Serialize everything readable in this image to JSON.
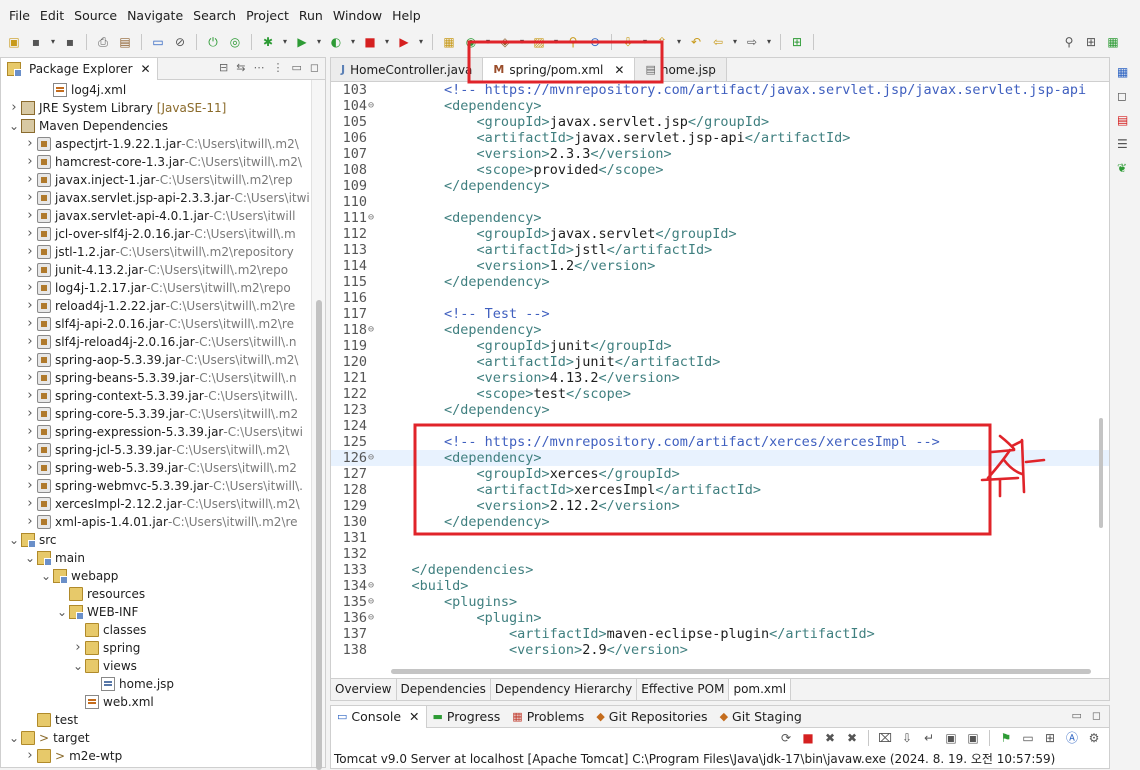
{
  "menus": [
    "File",
    "Edit",
    "Source",
    "Navigate",
    "Search",
    "Project",
    "Run",
    "Window",
    "Help"
  ],
  "toolbar_icons": [
    "new-icon",
    "save-icon",
    "save-all-icon",
    "print-icon",
    "properties-icon",
    "terminal-icon",
    "skip-icon",
    "power-icon",
    "refresh-icon",
    "debug-icon",
    "run-icon",
    "coverage-icon",
    "stop-icon",
    "external-tools-icon",
    "server-icon",
    "deploy-icon",
    "build-icon",
    "open-type-icon",
    "search-icon",
    "pin-icon",
    "next-annotation-icon",
    "prev-annotation-icon",
    "last-edit-icon",
    "back-icon",
    "forward-icon",
    "new-window-icon",
    "quick-access-icon",
    "open-perspective-icon",
    "java-perspective-icon"
  ],
  "explorer": {
    "title": "Package Explorer",
    "tree": [
      {
        "label": "log4j.xml",
        "icon": "xml",
        "depth": 3,
        "twisty": ""
      },
      {
        "label": "JRE System Library",
        "decoration": "[JavaSE-11]",
        "icon": "lib",
        "depth": 1,
        "twisty": "right"
      },
      {
        "label": "Maven Dependencies",
        "icon": "lib",
        "depth": 1,
        "twisty": "down"
      },
      {
        "label": "aspectjrt-1.9.22.1.jar",
        "path": "C:\\Users\\itwill\\.m2\\",
        "icon": "jar",
        "depth": 2,
        "twisty": "right"
      },
      {
        "label": "hamcrest-core-1.3.jar",
        "path": "C:\\Users\\itwill\\.m2\\",
        "icon": "jar",
        "depth": 2,
        "twisty": "right"
      },
      {
        "label": "javax.inject-1.jar",
        "path": "C:\\Users\\itwill\\.m2\\rep",
        "icon": "jar",
        "depth": 2,
        "twisty": "right"
      },
      {
        "label": "javax.servlet.jsp-api-2.3.3.jar",
        "path": "C:\\Users\\itwi",
        "icon": "jar",
        "depth": 2,
        "twisty": "right"
      },
      {
        "label": "javax.servlet-api-4.0.1.jar",
        "path": "C:\\Users\\itwill",
        "icon": "jar",
        "depth": 2,
        "twisty": "right"
      },
      {
        "label": "jcl-over-slf4j-2.0.16.jar",
        "path": "C:\\Users\\itwill\\.m",
        "icon": "jar",
        "depth": 2,
        "twisty": "right"
      },
      {
        "label": "jstl-1.2.jar",
        "path": "C:\\Users\\itwill\\.m2\\repository",
        "icon": "jar",
        "depth": 2,
        "twisty": "right"
      },
      {
        "label": "junit-4.13.2.jar",
        "path": "C:\\Users\\itwill\\.m2\\repo",
        "icon": "jar",
        "depth": 2,
        "twisty": "right"
      },
      {
        "label": "log4j-1.2.17.jar",
        "path": "C:\\Users\\itwill\\.m2\\repo",
        "icon": "jar",
        "depth": 2,
        "twisty": "right"
      },
      {
        "label": "reload4j-1.2.22.jar",
        "path": "C:\\Users\\itwill\\.m2\\re",
        "icon": "jar",
        "depth": 2,
        "twisty": "right"
      },
      {
        "label": "slf4j-api-2.0.16.jar",
        "path": "C:\\Users\\itwill\\.m2\\re",
        "icon": "jar",
        "depth": 2,
        "twisty": "right"
      },
      {
        "label": "slf4j-reload4j-2.0.16.jar",
        "path": "C:\\Users\\itwill\\.n",
        "icon": "jar",
        "depth": 2,
        "twisty": "right"
      },
      {
        "label": "spring-aop-5.3.39.jar",
        "path": "C:\\Users\\itwill\\.m2\\",
        "icon": "jar",
        "depth": 2,
        "twisty": "right"
      },
      {
        "label": "spring-beans-5.3.39.jar",
        "path": "C:\\Users\\itwill\\.n",
        "icon": "jar",
        "depth": 2,
        "twisty": "right"
      },
      {
        "label": "spring-context-5.3.39.jar",
        "path": "C:\\Users\\itwill\\.",
        "icon": "jar",
        "depth": 2,
        "twisty": "right"
      },
      {
        "label": "spring-core-5.3.39.jar",
        "path": "C:\\Users\\itwill\\.m2",
        "icon": "jar",
        "depth": 2,
        "twisty": "right"
      },
      {
        "label": "spring-expression-5.3.39.jar",
        "path": "C:\\Users\\itwi",
        "icon": "jar",
        "depth": 2,
        "twisty": "right"
      },
      {
        "label": "spring-jcl-5.3.39.jar",
        "path": "C:\\Users\\itwill\\.m2\\",
        "icon": "jar",
        "depth": 2,
        "twisty": "right"
      },
      {
        "label": "spring-web-5.3.39.jar",
        "path": "C:\\Users\\itwill\\.m2",
        "icon": "jar",
        "depth": 2,
        "twisty": "right"
      },
      {
        "label": "spring-webmvc-5.3.39.jar",
        "path": "C:\\Users\\itwill\\.",
        "icon": "jar",
        "depth": 2,
        "twisty": "right"
      },
      {
        "label": "xercesImpl-2.12.2.jar",
        "path": "C:\\Users\\itwill\\.m2\\",
        "icon": "jar",
        "depth": 2,
        "twisty": "right"
      },
      {
        "label": "xml-apis-1.4.01.jar",
        "path": "C:\\Users\\itwill\\.m2\\re",
        "icon": "jar",
        "depth": 2,
        "twisty": "right"
      },
      {
        "label": "src",
        "icon": "pkg",
        "depth": 1,
        "twisty": "down"
      },
      {
        "label": "main",
        "icon": "pkg",
        "depth": 2,
        "twisty": "down"
      },
      {
        "label": "webapp",
        "icon": "pkg",
        "depth": 3,
        "twisty": "down"
      },
      {
        "label": "resources",
        "icon": "folder",
        "depth": 4,
        "twisty": ""
      },
      {
        "label": "WEB-INF",
        "icon": "pkg",
        "depth": 4,
        "twisty": "down"
      },
      {
        "label": "classes",
        "icon": "folder",
        "depth": 5,
        "twisty": ""
      },
      {
        "label": "spring",
        "icon": "folder",
        "depth": 5,
        "twisty": "right"
      },
      {
        "label": "views",
        "icon": "folder",
        "depth": 5,
        "twisty": "down"
      },
      {
        "label": "home.jsp",
        "icon": "jsp",
        "depth": 6,
        "twisty": ""
      },
      {
        "label": "web.xml",
        "icon": "xml",
        "depth": 5,
        "twisty": ""
      },
      {
        "label": "test",
        "icon": "folder",
        "depth": 2,
        "twisty": ""
      },
      {
        "label": "target",
        "decoration": ">",
        "icon": "folder",
        "depth": 1,
        "twisty": "down",
        "decoration_first": true
      },
      {
        "label": "m2e-wtp",
        "decoration": ">",
        "icon": "folder",
        "depth": 2,
        "twisty": "right",
        "decoration_first": true
      }
    ]
  },
  "editor": {
    "tabs": [
      {
        "label": "HomeController.java",
        "icon": "java",
        "active": false,
        "closable": false
      },
      {
        "label": "spring/pom.xml",
        "icon": "pom",
        "active": true,
        "closable": true
      },
      {
        "label": "home.jsp",
        "icon": "jsp",
        "active": false,
        "closable": false
      }
    ],
    "lines": [
      {
        "n": 103,
        "fold": false,
        "segs": [
          [
            "cm",
            "        <!-- https://mvnrepository.com/artifact/javax.servlet.jsp/javax.servlet.jsp-api"
          ]
        ]
      },
      {
        "n": 104,
        "fold": true,
        "segs": [
          [
            "tag",
            "        <dependency>"
          ]
        ]
      },
      {
        "n": 105,
        "fold": false,
        "segs": [
          [
            "tag",
            "            <groupId>"
          ],
          [
            "txt",
            "javax.servlet.jsp"
          ],
          [
            "tag",
            "</groupId>"
          ]
        ]
      },
      {
        "n": 106,
        "fold": false,
        "segs": [
          [
            "tag",
            "            <artifactId>"
          ],
          [
            "txt",
            "javax.servlet.jsp-api"
          ],
          [
            "tag",
            "</artifactId>"
          ]
        ]
      },
      {
        "n": 107,
        "fold": false,
        "segs": [
          [
            "tag",
            "            <version>"
          ],
          [
            "txt",
            "2.3.3"
          ],
          [
            "tag",
            "</version>"
          ]
        ]
      },
      {
        "n": 108,
        "fold": false,
        "segs": [
          [
            "tag",
            "            <scope>"
          ],
          [
            "txt",
            "provided"
          ],
          [
            "tag",
            "</scope>"
          ]
        ]
      },
      {
        "n": 109,
        "fold": false,
        "segs": [
          [
            "tag",
            "        </dependency>"
          ]
        ]
      },
      {
        "n": 110,
        "fold": false,
        "segs": []
      },
      {
        "n": 111,
        "fold": true,
        "segs": [
          [
            "tag",
            "        <dependency>"
          ]
        ]
      },
      {
        "n": 112,
        "fold": false,
        "segs": [
          [
            "tag",
            "            <groupId>"
          ],
          [
            "txt",
            "javax.servlet"
          ],
          [
            "tag",
            "</groupId>"
          ]
        ]
      },
      {
        "n": 113,
        "fold": false,
        "segs": [
          [
            "tag",
            "            <artifactId>"
          ],
          [
            "txt",
            "jstl"
          ],
          [
            "tag",
            "</artifactId>"
          ]
        ]
      },
      {
        "n": 114,
        "fold": false,
        "segs": [
          [
            "tag",
            "            <version>"
          ],
          [
            "txt",
            "1.2"
          ],
          [
            "tag",
            "</version>"
          ]
        ]
      },
      {
        "n": 115,
        "fold": false,
        "segs": [
          [
            "tag",
            "        </dependency>"
          ]
        ]
      },
      {
        "n": 116,
        "fold": false,
        "segs": []
      },
      {
        "n": 117,
        "fold": false,
        "segs": [
          [
            "cm",
            "        <!-- Test -->"
          ]
        ]
      },
      {
        "n": 118,
        "fold": true,
        "segs": [
          [
            "tag",
            "        <dependency>"
          ]
        ]
      },
      {
        "n": 119,
        "fold": false,
        "segs": [
          [
            "tag",
            "            <groupId>"
          ],
          [
            "txt",
            "junit"
          ],
          [
            "tag",
            "</groupId>"
          ]
        ]
      },
      {
        "n": 120,
        "fold": false,
        "segs": [
          [
            "tag",
            "            <artifactId>"
          ],
          [
            "txt",
            "junit"
          ],
          [
            "tag",
            "</artifactId>"
          ]
        ]
      },
      {
        "n": 121,
        "fold": false,
        "segs": [
          [
            "tag",
            "            <version>"
          ],
          [
            "txt",
            "4.13.2"
          ],
          [
            "tag",
            "</version>"
          ]
        ]
      },
      {
        "n": 122,
        "fold": false,
        "segs": [
          [
            "tag",
            "            <scope>"
          ],
          [
            "txt",
            "test"
          ],
          [
            "tag",
            "</scope>"
          ]
        ]
      },
      {
        "n": 123,
        "fold": false,
        "segs": [
          [
            "tag",
            "        </dependency>"
          ]
        ]
      },
      {
        "n": 124,
        "fold": false,
        "segs": []
      },
      {
        "n": 125,
        "fold": false,
        "segs": [
          [
            "cm",
            "        <!-- https://mvnrepository.com/artifact/xerces/xercesImpl -->"
          ]
        ]
      },
      {
        "n": 126,
        "fold": true,
        "current": true,
        "segs": [
          [
            "tag",
            "        <dependency>"
          ]
        ]
      },
      {
        "n": 127,
        "fold": false,
        "segs": [
          [
            "tag",
            "            <groupId>"
          ],
          [
            "txt",
            "xerces"
          ],
          [
            "tag",
            "</groupId>"
          ]
        ]
      },
      {
        "n": 128,
        "fold": false,
        "segs": [
          [
            "tag",
            "            <artifactId>"
          ],
          [
            "txt",
            "xercesImpl"
          ],
          [
            "tag",
            "</artifactId>"
          ]
        ]
      },
      {
        "n": 129,
        "fold": false,
        "segs": [
          [
            "tag",
            "            <version>"
          ],
          [
            "txt",
            "2.12.2"
          ],
          [
            "tag",
            "</version>"
          ]
        ]
      },
      {
        "n": 130,
        "fold": false,
        "segs": [
          [
            "tag",
            "        </dependency>"
          ]
        ]
      },
      {
        "n": 131,
        "fold": false,
        "segs": []
      },
      {
        "n": 132,
        "fold": false,
        "segs": []
      },
      {
        "n": 133,
        "fold": false,
        "segs": [
          [
            "tag",
            "    </dependencies>"
          ]
        ]
      },
      {
        "n": 134,
        "fold": true,
        "segs": [
          [
            "tag",
            "    <build>"
          ]
        ]
      },
      {
        "n": 135,
        "fold": true,
        "segs": [
          [
            "tag",
            "        <plugins>"
          ]
        ]
      },
      {
        "n": 136,
        "fold": true,
        "segs": [
          [
            "tag",
            "            <plugin>"
          ]
        ]
      },
      {
        "n": 137,
        "fold": false,
        "segs": [
          [
            "tag",
            "                <artifactId>"
          ],
          [
            "txt",
            "maven-eclipse-plugin"
          ],
          [
            "tag",
            "</artifactId>"
          ]
        ]
      },
      {
        "n": 138,
        "fold": false,
        "segs": [
          [
            "tag",
            "                <version>"
          ],
          [
            "txt",
            "2.9"
          ],
          [
            "tag",
            "</version>"
          ]
        ]
      }
    ],
    "bottom_tabs": [
      "Overview",
      "Dependencies",
      "Dependency Hierarchy",
      "Effective POM",
      "pom.xml"
    ],
    "active_bottom_tab": "pom.xml"
  },
  "console": {
    "tabs": [
      {
        "label": "Console",
        "icon": "console-icon",
        "active": true,
        "closable": true
      },
      {
        "label": "Progress",
        "icon": "progress-icon"
      },
      {
        "label": "Problems",
        "icon": "problems-icon"
      },
      {
        "label": "Git Repositories",
        "icon": "git-repositories-icon"
      },
      {
        "label": "Git Staging",
        "icon": "git-staging-icon"
      }
    ],
    "status": "Tomcat v9.0 Server at localhost [Apache Tomcat] C:\\Program Files\\Java\\jdk-17\\bin\\javaw.exe  (2024. 8. 19. 오전 10:57:59)"
  },
  "annotation_color": "#e0242a"
}
